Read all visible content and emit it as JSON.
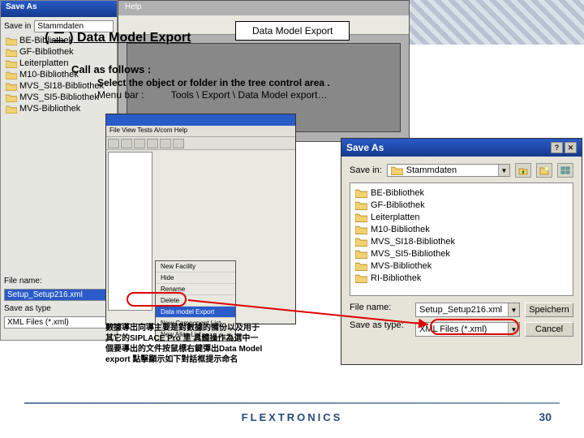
{
  "heading": "( 二 ) Data Model Export",
  "label_box": "Data Model Export",
  "call_line": "Call as follows :",
  "instr1": "Select the object or folder in the tree control area .",
  "instr2_prefix": "Menu bar :",
  "instr2_path": "Tools \\ Export \\ Data Model export…",
  "bg_dialog_left": {
    "title": "Save As",
    "save_in_label": "Save in",
    "save_in_value": "Stammdaten",
    "folders": [
      "BE-Bibliothek",
      "GF-Bibliothek",
      "Leiterplatten",
      "M10-Bibliothek",
      "MVS_SI18-Bibliothek",
      "MVS_SI5-Bibliothek",
      "MVS-Bibliothek"
    ],
    "file_name_label": "File name:",
    "file_name_value": "Setup_Setup216.xml",
    "save_type_label": "Save as type",
    "save_type_value": "XML Files (*.xml)"
  },
  "bg_window_top": {
    "menu": "Help"
  },
  "mini_app": {
    "menu_bar": "File View Tests A/com Help",
    "popup_items": [
      "New Facility",
      "Hide",
      "Rename",
      "Delete",
      "Data model Export",
      "New Component List",
      "New Alias List"
    ],
    "highlight_index": 4
  },
  "save_as": {
    "title": "Save As",
    "save_in_label": "Save in:",
    "save_in_value": "Stammdaten",
    "folders": [
      "BE-Bibliothek",
      "GF-Bibliothek",
      "Leiterplatten",
      "M10-Bibliothek",
      "MVS_SI18-Bibliothek",
      "MVS_SI5-Bibliothek",
      "MVS-Bibliothek",
      "RI-Bibliothek"
    ],
    "file_name_label": "File name:",
    "file_name_value": "Setup_Setup216.xml",
    "save_type_label": "Save as type:",
    "save_type_value": "XML Files (*.xml)",
    "save_button": "Speichern",
    "cancel_button": "Cancel"
  },
  "chinese_note": "數據導出向導主要是對數據的備份以及用于其它的SIPLACE Pro 里 具體操作為選中一個要導出的文件按鼠標右鍵彈出Data Model export 點擊顯示如下對話框提示命名",
  "footer_logo": "FLEXTRONICS",
  "page_number": "30"
}
